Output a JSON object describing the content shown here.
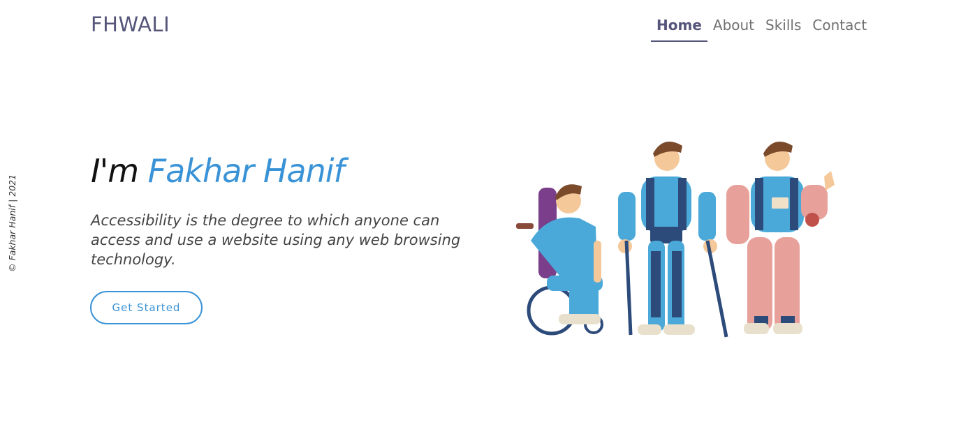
{
  "header": {
    "brand": "FHWALI",
    "nav": [
      {
        "label": "Home",
        "active": true
      },
      {
        "label": "About",
        "active": false
      },
      {
        "label": "Skills",
        "active": false
      },
      {
        "label": "Contact",
        "active": false
      }
    ]
  },
  "sidebar": {
    "credit": "© Fakhar Hanif | 2021"
  },
  "hero": {
    "intro": "I'm",
    "name": "Fakhar Hanif",
    "description": "Accessibility is the degree to which anyone can access and use a website using any web browsing technology.",
    "cta_label": "Get Started"
  },
  "illustration": {
    "icon": "accessibility-figures-illustration"
  },
  "colors": {
    "accent": "#3a93d6",
    "brand": "#55557a",
    "figure_blue": "#4aa9d8",
    "figure_navy": "#2d4b7a",
    "skin": "#f5c89a",
    "hair": "#7a4a2a"
  }
}
